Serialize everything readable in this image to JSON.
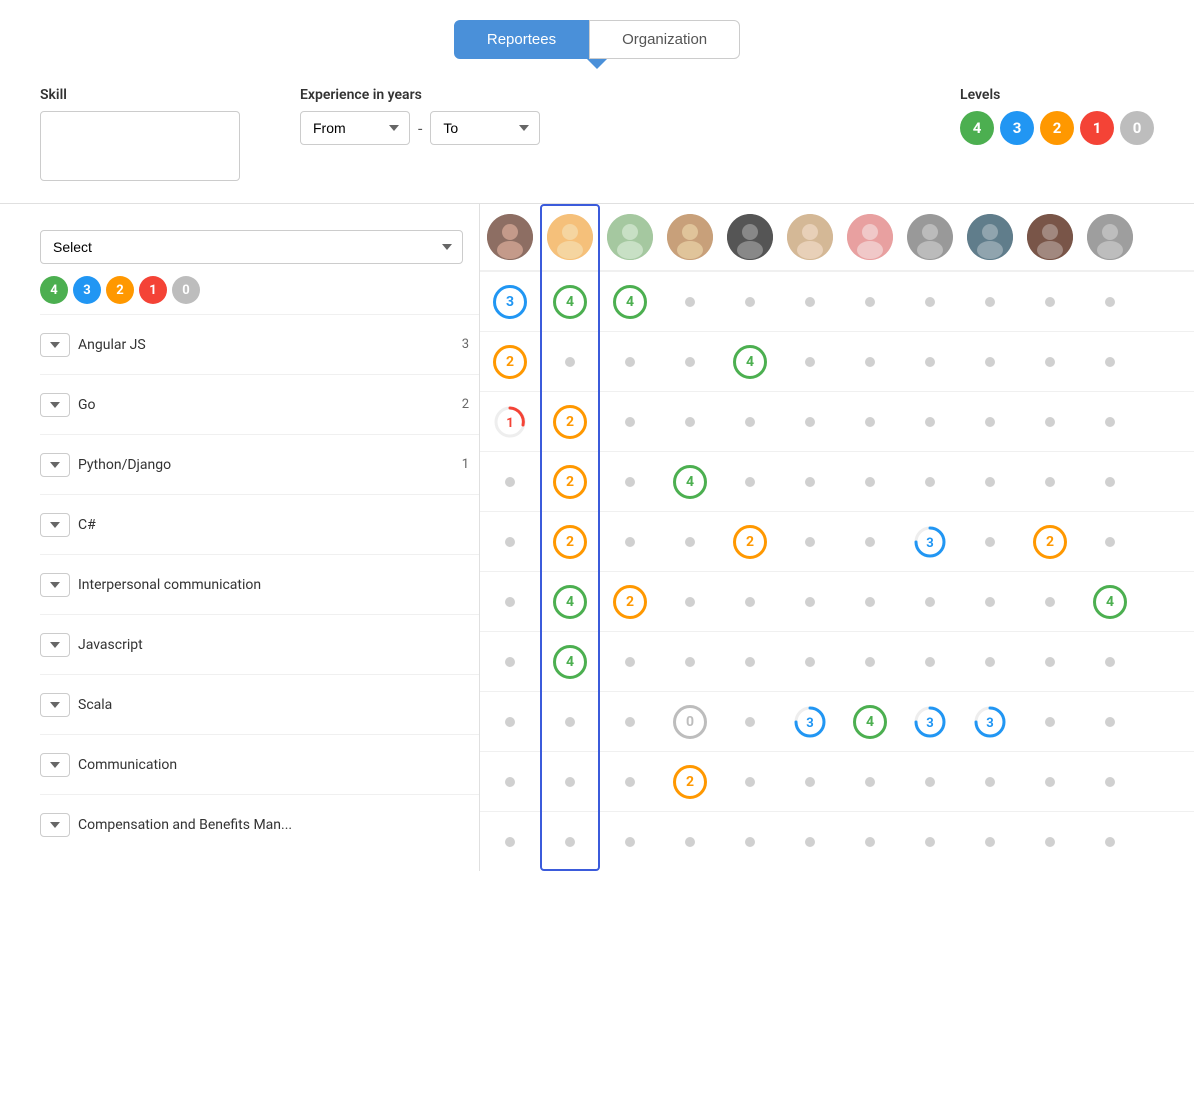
{
  "tabs": [
    {
      "id": "reportees",
      "label": "Reportees",
      "active": true
    },
    {
      "id": "organization",
      "label": "Organization",
      "active": false
    }
  ],
  "filters": {
    "skill_label": "Skill",
    "skill_placeholder": "",
    "experience_label": "Experience in years",
    "from_label": "From",
    "to_label": "To",
    "levels_label": "Levels"
  },
  "levels": [
    {
      "value": "4",
      "class": "lv4"
    },
    {
      "value": "3",
      "class": "lv3"
    },
    {
      "value": "2",
      "class": "lv2"
    },
    {
      "value": "1",
      "class": "lv1"
    },
    {
      "value": "0",
      "class": "lv0"
    }
  ],
  "skills_select_label": "Select",
  "skills": [
    {
      "name": "Angular JS",
      "count": "3"
    },
    {
      "name": "Go",
      "count": "2"
    },
    {
      "name": "Python/Django",
      "count": "1"
    },
    {
      "name": "C#",
      "count": ""
    },
    {
      "name": "Interpersonal communication",
      "count": ""
    },
    {
      "name": "Javascript",
      "count": ""
    },
    {
      "name": "Scala",
      "count": ""
    },
    {
      "name": "Communication",
      "count": ""
    },
    {
      "name": "Compensation and Benefits Man...",
      "count": ""
    }
  ],
  "persons": [
    {
      "id": 1,
      "avatar_class": "av1",
      "highlighted": false
    },
    {
      "id": 2,
      "avatar_class": "av2",
      "highlighted": true
    },
    {
      "id": 3,
      "avatar_class": "av3",
      "highlighted": false
    },
    {
      "id": 4,
      "avatar_class": "av4",
      "highlighted": false
    },
    {
      "id": 5,
      "avatar_class": "av5",
      "highlighted": false
    },
    {
      "id": 6,
      "avatar_class": "av6",
      "highlighted": false
    },
    {
      "id": 7,
      "avatar_class": "av7",
      "highlighted": false
    },
    {
      "id": 8,
      "avatar_class": "av8",
      "highlighted": false
    },
    {
      "id": 9,
      "avatar_class": "av9",
      "highlighted": false
    },
    {
      "id": 10,
      "avatar_class": "av10",
      "highlighted": false
    },
    {
      "id": 11,
      "avatar_class": "av11",
      "highlighted": false
    }
  ],
  "grid_data": {
    "angular_js": [
      "3-blue",
      "4-green",
      "4-green",
      "",
      "",
      "",
      "",
      "",
      "",
      "",
      ""
    ],
    "go": [
      "2-orange",
      "",
      "",
      "",
      "4-green",
      "",
      "",
      "",
      "",
      "",
      ""
    ],
    "python_django": [
      "1-red",
      "2-orange",
      "",
      "",
      "",
      "",
      "",
      "",
      "",
      "",
      ""
    ],
    "csharp": [
      "",
      "2-orange",
      "",
      "4-green",
      "",
      "",
      "",
      "",
      "",
      "",
      ""
    ],
    "interpersonal": [
      "",
      "2-orange",
      "",
      "",
      "2-orange",
      "",
      "",
      "3-blue",
      "",
      "2-orange",
      ""
    ],
    "javascript": [
      "",
      "4-green",
      "2-orange",
      "",
      "",
      "",
      "",
      "",
      "",
      "",
      "4-green"
    ],
    "scala": [
      "",
      "4-green",
      "",
      "",
      "",
      "",
      "",
      "",
      "",
      "",
      ""
    ],
    "communication": [
      "",
      "",
      "",
      "0-gray",
      "",
      "3-blue",
      "4-green",
      "3-blue",
      "3-blue",
      "",
      ""
    ],
    "compensation": [
      "",
      "",
      "",
      "2-orange",
      "",
      "",
      "",
      "",
      "",
      "",
      ""
    ]
  }
}
